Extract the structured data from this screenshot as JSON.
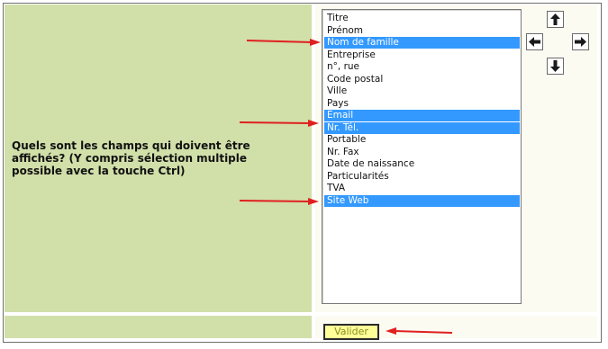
{
  "question": "Quels sont les champs qui doivent être affichés? (Y compris sélection multiple possible avec la touche Ctrl)",
  "fields": [
    {
      "label": "Titre",
      "selected": false
    },
    {
      "label": "Prénom",
      "selected": false
    },
    {
      "label": "Nom de famille",
      "selected": true
    },
    {
      "label": "Entreprise",
      "selected": false
    },
    {
      "label": "n°, rue",
      "selected": false
    },
    {
      "label": "Code postal",
      "selected": false
    },
    {
      "label": "Ville",
      "selected": false
    },
    {
      "label": "Pays",
      "selected": false
    },
    {
      "label": "Email",
      "selected": true
    },
    {
      "label": "Nr. Tél.",
      "selected": true
    },
    {
      "label": "Portable",
      "selected": false
    },
    {
      "label": "Nr. Fax",
      "selected": false
    },
    {
      "label": "Date de naissance",
      "selected": false
    },
    {
      "label": "Particularités",
      "selected": false
    },
    {
      "label": "TVA",
      "selected": false
    },
    {
      "label": "Site Web",
      "selected": true
    }
  ],
  "buttons": {
    "submit_label": "Valider",
    "up_icon": "arrow-up-icon",
    "down_icon": "arrow-down-icon",
    "left_icon": "arrow-left-icon",
    "right_icon": "arrow-right-icon"
  },
  "colors": {
    "label_bg": "#d1dfa9",
    "input_bg": "#fbfbf2",
    "selection": "#3399ff",
    "submit_bg": "#ffff99",
    "annotation_arrow": "#e02020"
  }
}
